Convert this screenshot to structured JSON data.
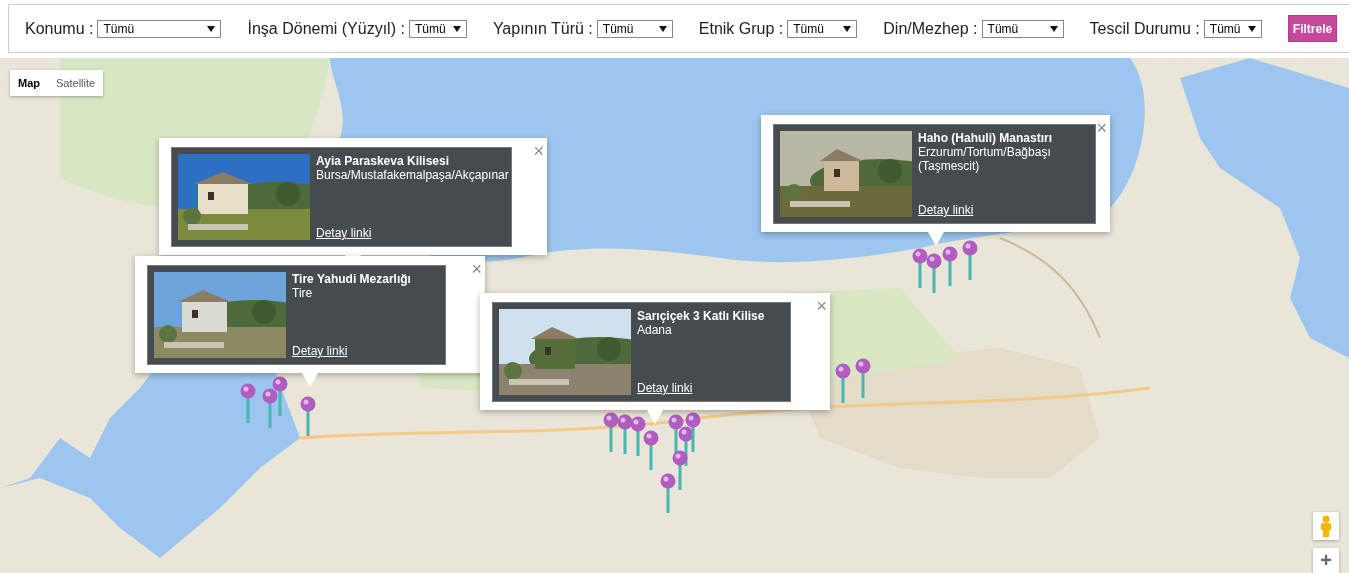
{
  "filters": [
    {
      "label": "Konumu :",
      "value": "Tümü"
    },
    {
      "label": "İnşa Dönemi (Yüzyıl) :",
      "value": "Tümü"
    },
    {
      "label": "Yapının Türü :",
      "value": "Tümü"
    },
    {
      "label": "Etnik Grup :",
      "value": "Tümü"
    },
    {
      "label": "Din/Mezhep :",
      "value": "Tümü"
    },
    {
      "label": "Tescil Durumu :",
      "value": "Tümü"
    }
  ],
  "filter_button": "Filtrele",
  "map": {
    "map_type_tabs": [
      {
        "label": "Map",
        "selected": true
      },
      {
        "label": "Satellite",
        "selected": false
      }
    ],
    "info_windows": [
      {
        "title": "Ayia Paraskeva Kilisesi",
        "location": "Bursa/Mustafakemalpaşa/Akçapınar",
        "link": "Detay linki",
        "close": "×"
      },
      {
        "title": "Tire Yahudi Mezarlığı",
        "location": "Tire",
        "link": "Detay linki",
        "close": "×"
      },
      {
        "title": "Sarıçiçek 3 Katlı Kilise",
        "location": "Adana",
        "link": "Detay linki",
        "close": "×"
      },
      {
        "title": "Haho (Hahuli) Manastırı",
        "location": "Erzurum/Tortum/Bağbaşı (Taşmescit)",
        "link": "Detay linki",
        "close": "×"
      }
    ],
    "zoom_in": "+"
  }
}
